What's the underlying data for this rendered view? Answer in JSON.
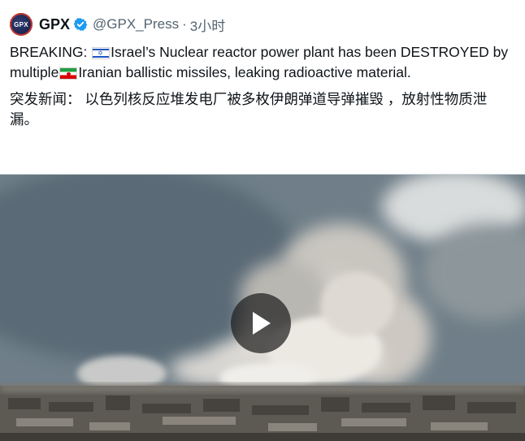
{
  "author": {
    "avatar_text": "GPX",
    "name": "GPX",
    "handle": "@GPX_Press",
    "separator": "·",
    "time": "3小时"
  },
  "post": {
    "text_en_part1": "BREAKING: ",
    "text_en_part2": "Israel’s Nuclear reactor power plant has been DESTROYED by multiple",
    "text_en_part3": "Iranian ballistic missiles, leaking radioactive material.",
    "text_zh": "突发新闻： 以色列核反应堆发电厂被多枚伊朗弹道导弹摧毁 ，放射性物质泄漏。"
  },
  "icons": {
    "verified": "verified-badge-icon",
    "flag_israel": "israel-flag-icon",
    "flag_iran": "iran-flag-icon",
    "play": "play-icon"
  },
  "colors": {
    "text_primary": "#0f1419",
    "text_secondary": "#536471",
    "verified_blue": "#1d9bf0",
    "play_overlay": "#1e1e1e"
  }
}
